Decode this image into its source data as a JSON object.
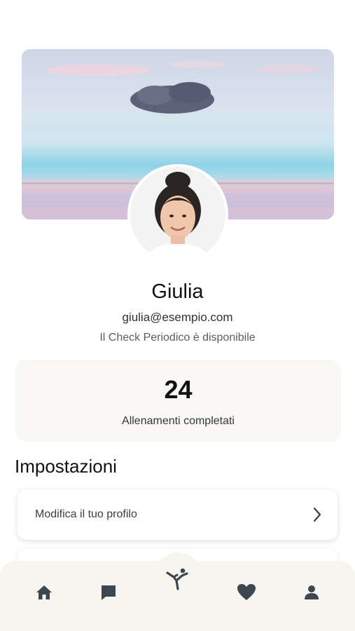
{
  "profile": {
    "name": "Giulia",
    "email": "giulia@esempio.com",
    "check_status": "Il Check Periodico è disponibile"
  },
  "stats": {
    "count": "24",
    "label": "Allenamenti completati"
  },
  "settings": {
    "title": "Impostazioni",
    "items": [
      {
        "label": "Modifica il tuo profilo",
        "icon": "chevron-right-icon"
      }
    ]
  },
  "nav": {
    "items": [
      {
        "icon": "home-icon"
      },
      {
        "icon": "chat-icon"
      },
      {
        "icon": "workout-icon"
      },
      {
        "icon": "heart-icon"
      },
      {
        "icon": "person-icon"
      }
    ]
  },
  "colors": {
    "nav_icon": "#3d4750",
    "nav_background": "#f7f5f0",
    "stats_background": "#faf8f4"
  }
}
